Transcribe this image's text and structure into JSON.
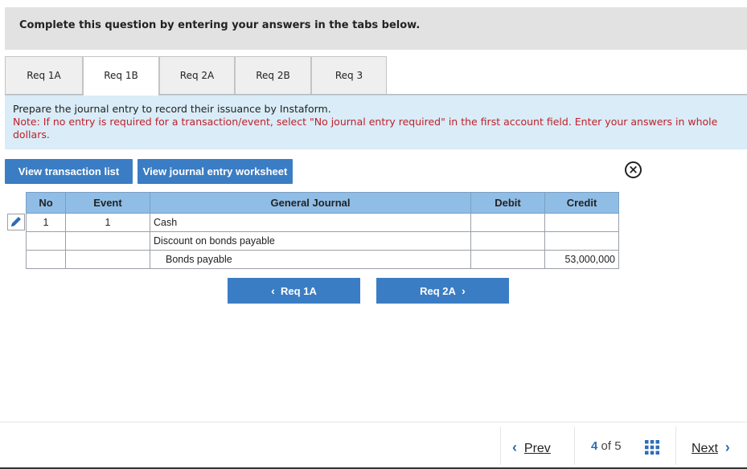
{
  "header": {
    "title": "Complete this question by entering your answers in the tabs below."
  },
  "tabs": [
    {
      "label": "Req 1A",
      "active": false
    },
    {
      "label": "Req 1B",
      "active": true
    },
    {
      "label": "Req 2A",
      "active": false
    },
    {
      "label": "Req 2B",
      "active": false
    },
    {
      "label": "Req 3",
      "active": false
    }
  ],
  "instructions": {
    "text": "Prepare the journal entry to record their issuance by Instaform.",
    "note": "Note: If no entry is required for a transaction/event, select \"No journal entry required\" in the first account field. Enter your answers in whole dollars."
  },
  "toolbar": {
    "view_transaction_list": "View transaction list",
    "view_journal_worksheet": "View journal entry worksheet",
    "close_icon": "circle-x-icon"
  },
  "journal": {
    "headers": {
      "no": "No",
      "event": "Event",
      "general_journal": "General Journal",
      "debit": "Debit",
      "credit": "Credit"
    },
    "rows": [
      {
        "no": "1",
        "event": "1",
        "account": "Cash",
        "debit": "",
        "credit": ""
      },
      {
        "no": "",
        "event": "",
        "account": "Discount on bonds payable",
        "debit": "",
        "credit": ""
      },
      {
        "no": "",
        "event": "",
        "account": "Bonds payable",
        "debit": "",
        "credit": "53,000,000"
      }
    ],
    "edit_icon": "pencil-icon"
  },
  "nav": {
    "prev_label": "Req 1A",
    "next_label": "Req 2A"
  },
  "footer": {
    "prev": "Prev",
    "page_current": "4",
    "page_of": "of",
    "page_total": "5",
    "next": "Next",
    "grid_icon": "grid-icon"
  },
  "colors": {
    "accent_blue": "#3b7dc4",
    "header_blue": "#8fbde6",
    "note_red": "#c0202a",
    "instruction_bg": "#d9ecf7"
  }
}
